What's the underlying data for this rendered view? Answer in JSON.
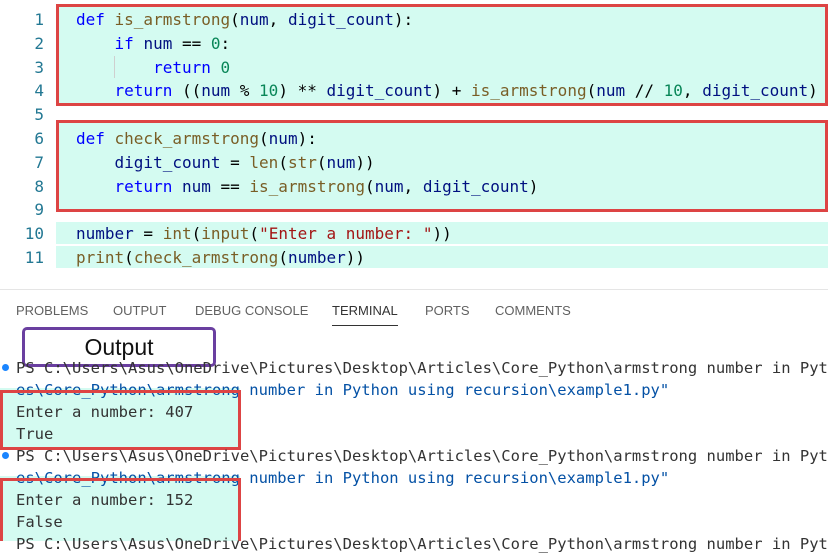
{
  "editor": {
    "breadcrumb": "example1.py",
    "lines": [
      {
        "n": "1",
        "segs": [
          {
            "t": "def ",
            "c": "kw"
          },
          {
            "t": "is_armstrong",
            "c": "fn"
          },
          {
            "t": "(",
            "c": ""
          },
          {
            "t": "num",
            "c": "var"
          },
          {
            "t": ", ",
            "c": ""
          },
          {
            "t": "digit_count",
            "c": "var"
          },
          {
            "t": "):",
            "c": ""
          }
        ]
      },
      {
        "n": "2",
        "segs": [
          {
            "t": "    if ",
            "c": "kw"
          },
          {
            "t": "num",
            "c": "var"
          },
          {
            "t": " == ",
            "c": ""
          },
          {
            "t": "0",
            "c": "num"
          },
          {
            "t": ":",
            "c": ""
          }
        ]
      },
      {
        "n": "3",
        "segs": [
          {
            "t": "        return ",
            "c": "kw"
          },
          {
            "t": "0",
            "c": "num"
          }
        ]
      },
      {
        "n": "4",
        "segs": [
          {
            "t": "    return ",
            "c": "kw"
          },
          {
            "t": "((",
            "c": ""
          },
          {
            "t": "num",
            "c": "var"
          },
          {
            "t": " % ",
            "c": ""
          },
          {
            "t": "10",
            "c": "num"
          },
          {
            "t": ") ** ",
            "c": ""
          },
          {
            "t": "digit_count",
            "c": "var"
          },
          {
            "t": ") + ",
            "c": ""
          },
          {
            "t": "is_armstrong",
            "c": "fn"
          },
          {
            "t": "(",
            "c": ""
          },
          {
            "t": "num",
            "c": "var"
          },
          {
            "t": " // ",
            "c": ""
          },
          {
            "t": "10",
            "c": "num"
          },
          {
            "t": ", ",
            "c": ""
          },
          {
            "t": "digit_count",
            "c": "var"
          },
          {
            "t": ")",
            "c": ""
          }
        ]
      },
      {
        "n": "5",
        "segs": []
      },
      {
        "n": "6",
        "segs": [
          {
            "t": "def ",
            "c": "kw"
          },
          {
            "t": "check_armstrong",
            "c": "fn"
          },
          {
            "t": "(",
            "c": ""
          },
          {
            "t": "num",
            "c": "var"
          },
          {
            "t": "):",
            "c": ""
          }
        ]
      },
      {
        "n": "7",
        "segs": [
          {
            "t": "    digit_count",
            "c": "var"
          },
          {
            "t": " = ",
            "c": ""
          },
          {
            "t": "len",
            "c": "fn"
          },
          {
            "t": "(",
            "c": ""
          },
          {
            "t": "str",
            "c": "fn"
          },
          {
            "t": "(",
            "c": ""
          },
          {
            "t": "num",
            "c": "var"
          },
          {
            "t": "))",
            "c": ""
          }
        ]
      },
      {
        "n": "8",
        "segs": [
          {
            "t": "    return ",
            "c": "kw"
          },
          {
            "t": "num",
            "c": "var"
          },
          {
            "t": " == ",
            "c": ""
          },
          {
            "t": "is_armstrong",
            "c": "fn"
          },
          {
            "t": "(",
            "c": ""
          },
          {
            "t": "num",
            "c": "var"
          },
          {
            "t": ", ",
            "c": ""
          },
          {
            "t": "digit_count",
            "c": "var"
          },
          {
            "t": ")",
            "c": ""
          }
        ]
      },
      {
        "n": "9",
        "segs": []
      },
      {
        "n": "10",
        "segs": [
          {
            "t": "number",
            "c": "var"
          },
          {
            "t": " = ",
            "c": ""
          },
          {
            "t": "int",
            "c": "fn"
          },
          {
            "t": "(",
            "c": ""
          },
          {
            "t": "input",
            "c": "fn"
          },
          {
            "t": "(",
            "c": ""
          },
          {
            "t": "\"Enter a number: \"",
            "c": "str"
          },
          {
            "t": "))",
            "c": ""
          }
        ]
      },
      {
        "n": "11",
        "segs": [
          {
            "t": "print",
            "c": "fn"
          },
          {
            "t": "(",
            "c": ""
          },
          {
            "t": "check_armstrong",
            "c": "fn"
          },
          {
            "t": "(",
            "c": ""
          },
          {
            "t": "number",
            "c": "var"
          },
          {
            "t": "))",
            "c": ""
          }
        ]
      }
    ]
  },
  "panel": {
    "tabs": [
      "PROBLEMS",
      "OUTPUT",
      "DEBUG CONSOLE",
      "TERMINAL",
      "PORTS",
      "COMMENTS"
    ],
    "active_tab": "TERMINAL",
    "output_label": "Output",
    "terminal": {
      "run1_cmd": "PS C:\\Users\\Asus\\OneDrive\\Pictures\\Desktop\\Articles\\Core_Python\\armstrong number in Python",
      "run1_cmd2": "es\\Core_Python\\armstrong number in Python using recursion\\example1.py\"",
      "run1_prompt": "Enter a number: 407",
      "run1_result": "True",
      "run2_cmd": "PS C:\\Users\\Asus\\OneDrive\\Pictures\\Desktop\\Articles\\Core_Python\\armstrong number in Python",
      "run2_cmd2": "es\\Core_Python\\armstrong number in Python using recursion\\example1.py\"",
      "run2_prompt": "Enter a number: 152",
      "run2_result": "False",
      "run3_cmd": "PS C:\\Users\\Asus\\OneDrive\\Pictures\\Desktop\\Articles\\Core_Python\\armstrong number in Python"
    }
  },
  "colors": {
    "highlight": "#d4fbf1",
    "box_red": "#dd4444",
    "label_purple": "#6a3fa0",
    "terminal_dot": "#1a85ff"
  }
}
